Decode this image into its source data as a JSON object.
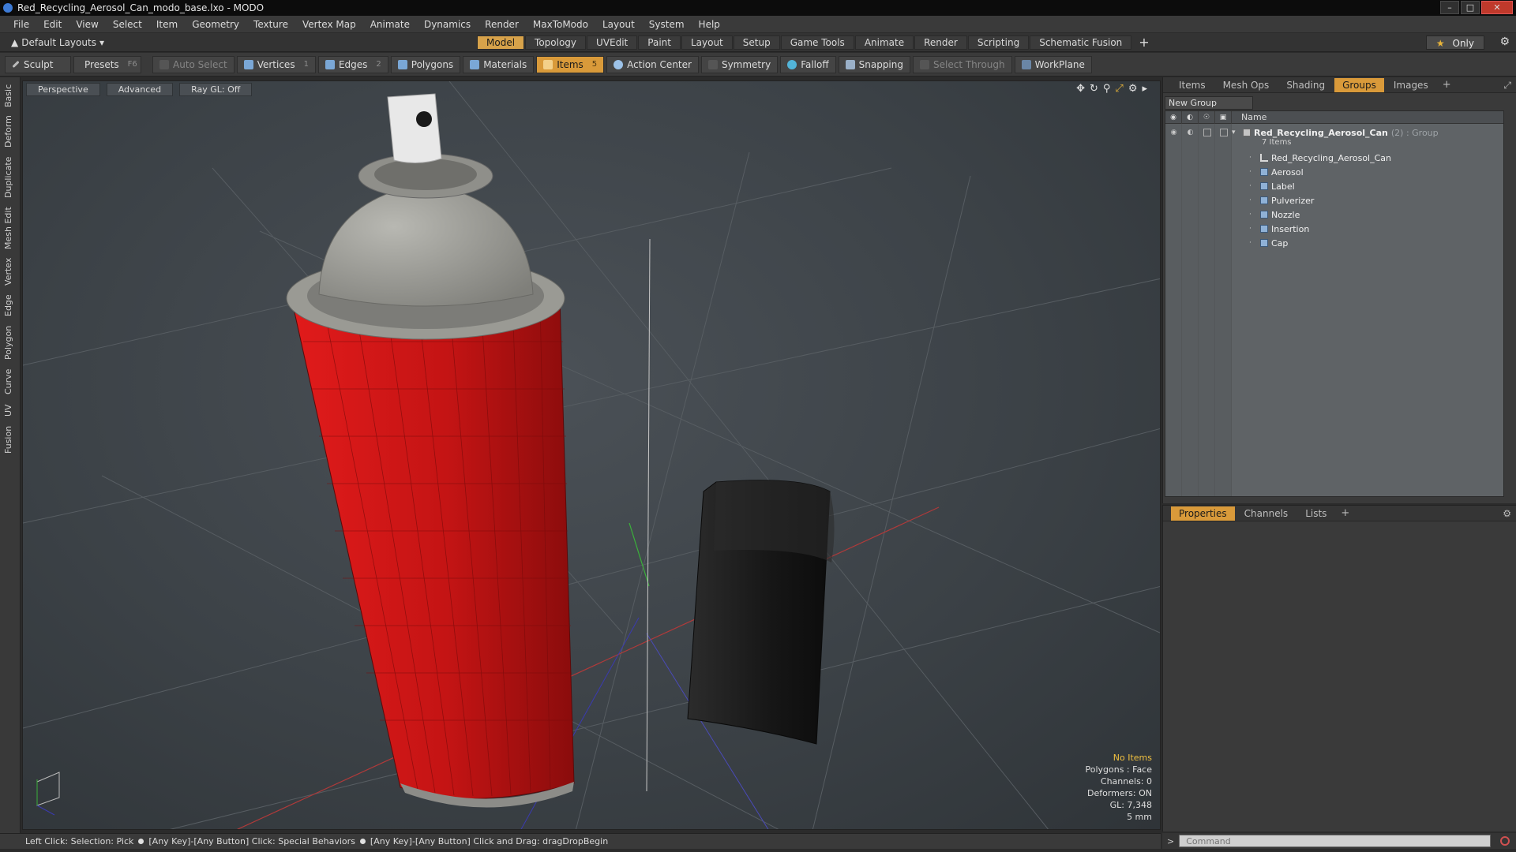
{
  "window": {
    "title": "Red_Recycling_Aerosol_Can_modo_base.lxo - MODO",
    "controls": {
      "minimize": "–",
      "maximize": "□",
      "close": "✕"
    }
  },
  "menu": [
    "File",
    "Edit",
    "View",
    "Select",
    "Item",
    "Geometry",
    "Texture",
    "Vertex Map",
    "Animate",
    "Dynamics",
    "Render",
    "MaxToModo",
    "Layout",
    "System",
    "Help"
  ],
  "layout_bar": {
    "layout_selector": "Default Layouts",
    "tabs": [
      "Model",
      "Topology",
      "UVEdit",
      "Paint",
      "Layout",
      "Setup",
      "Game Tools",
      "Animate",
      "Render",
      "Scripting",
      "Schematic Fusion"
    ],
    "active_tab": "Model",
    "add": "+",
    "only_label": "Only",
    "gear": "⚙"
  },
  "toolbar": {
    "sculpt": "Sculpt",
    "presets": "Presets",
    "presets_key": "F6",
    "auto_select": "Auto Select",
    "vertices": "Vertices",
    "vertices_key": "1",
    "edges": "Edges",
    "edges_key": "2",
    "polygons": "Polygons",
    "materials": "Materials",
    "items": "Items",
    "items_key": "5",
    "action_center": "Action Center",
    "symmetry": "Symmetry",
    "falloff": "Falloff",
    "snapping": "Snapping",
    "select_through": "Select Through",
    "workplane": "WorkPlane"
  },
  "left_tabs": [
    "Basic",
    "Deform",
    "Duplicate",
    "Mesh Edit",
    "Vertex",
    "Edge",
    "Polygon",
    "Curve",
    "UV",
    "Fusion"
  ],
  "viewport": {
    "view": "Perspective",
    "shading": "Advanced",
    "raygl": "Ray GL: Off",
    "info": {
      "selection": "No Items",
      "polygons": "Polygons : Face",
      "channels": "Channels: 0",
      "deformers": "Deformers: ON",
      "gl": "GL: 7,348",
      "scale": "5 mm"
    },
    "colors": {
      "can_red": "#c81414",
      "cap_black": "#1a1a1a",
      "top_gray": "#9a9a94"
    }
  },
  "status": {
    "left_click": "Left Click: Selection: Pick",
    "any_click": "[Any Key]-[Any Button] Click: Special Behaviors",
    "any_drag": "[Any Key]-[Any Button] Click and Drag: dragDropBegin"
  },
  "groups_panel": {
    "tabs": [
      "Items",
      "Mesh Ops",
      "Shading",
      "Groups",
      "Images"
    ],
    "active_tab": "Groups",
    "new_group": "New Group",
    "name_header": "Name",
    "group": {
      "name": "Red_Recycling_Aerosol_Can",
      "suffix": "(2) : Group",
      "count": "7 Items",
      "children": [
        "Red_Recycling_Aerosol_Can",
        "Aerosol",
        "Label",
        "Pulverizer",
        "Nozzle",
        "Insertion",
        "Cap"
      ]
    }
  },
  "properties_panel": {
    "tabs": [
      "Properties",
      "Channels",
      "Lists"
    ],
    "active_tab": "Properties"
  },
  "command": {
    "placeholder": "Command"
  }
}
